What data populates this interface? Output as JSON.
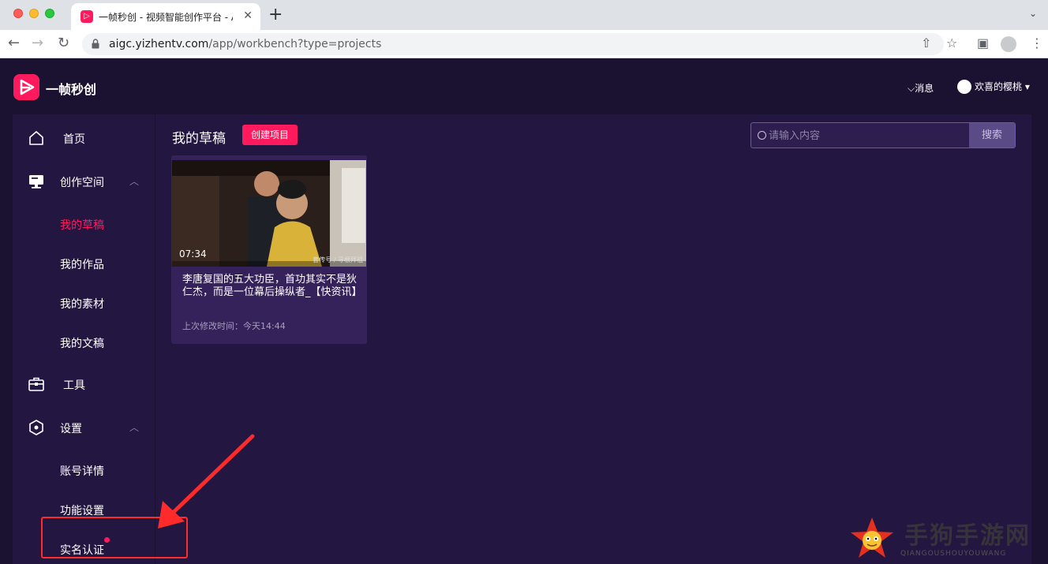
{
  "browser": {
    "tab_title": "一帧秒创 - 视频智能创作平台 - AI",
    "tab_favicon_text": "▷",
    "tab_close": "✕",
    "new_tab": "+",
    "tab_menu": "⌄",
    "url_host": "aigc.yizhentv.com",
    "url_path": "/app/workbench?type=projects",
    "back_icon": "←",
    "forward_icon": "→",
    "reload_icon": "↻",
    "share_icon": "⇧",
    "star_icon": "☆",
    "sidepanel_icon": "▣",
    "menu_icon": "⋮"
  },
  "header": {
    "brand": "一帧秒创",
    "messages": "消息",
    "user": "欢喜的樱桃"
  },
  "sidebar": {
    "home": "首页",
    "creative_space": "创作空间",
    "drafts": "我的草稿",
    "works": "我的作品",
    "materials": "我的素材",
    "documents": "我的文稿",
    "tools": "工具",
    "settings": "设置",
    "account": "账号详情",
    "features": "功能设置",
    "verification": "实名认证",
    "caret": "︿"
  },
  "main": {
    "title": "我的草稿",
    "create_button": "创建项目",
    "search_placeholder": "请输入内容",
    "search_button": "搜索",
    "cards": [
      {
        "duration": "07:34",
        "title": "李唐复国的五大功臣，首功其实不是狄仁杰，而是一位幕后操纵者_【快资讯】",
        "modified": "上次修改时间：今天14:44",
        "thumb_caption": "套传号 / 寻根拜祖"
      }
    ]
  },
  "watermark": {
    "text": "手狗手游网",
    "sub": "QIANGOUSHOUYOUWANG"
  },
  "colors": {
    "accent": "#ff1a5e",
    "app_bg": "#1b1130",
    "panel_bg": "#231640",
    "card_bg": "#35225a"
  }
}
